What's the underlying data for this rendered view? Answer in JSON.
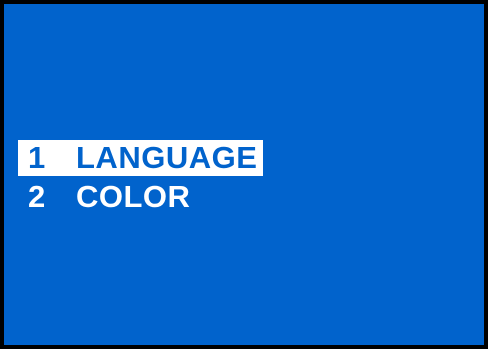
{
  "menu": {
    "items": [
      {
        "number": "1",
        "label": "LANGUAGE",
        "selected": true
      },
      {
        "number": "2",
        "label": "COLOR",
        "selected": false
      }
    ]
  },
  "colors": {
    "background": "#0163cc",
    "text": "#ffffff",
    "highlight": "#ffffff",
    "border": "#000000"
  }
}
